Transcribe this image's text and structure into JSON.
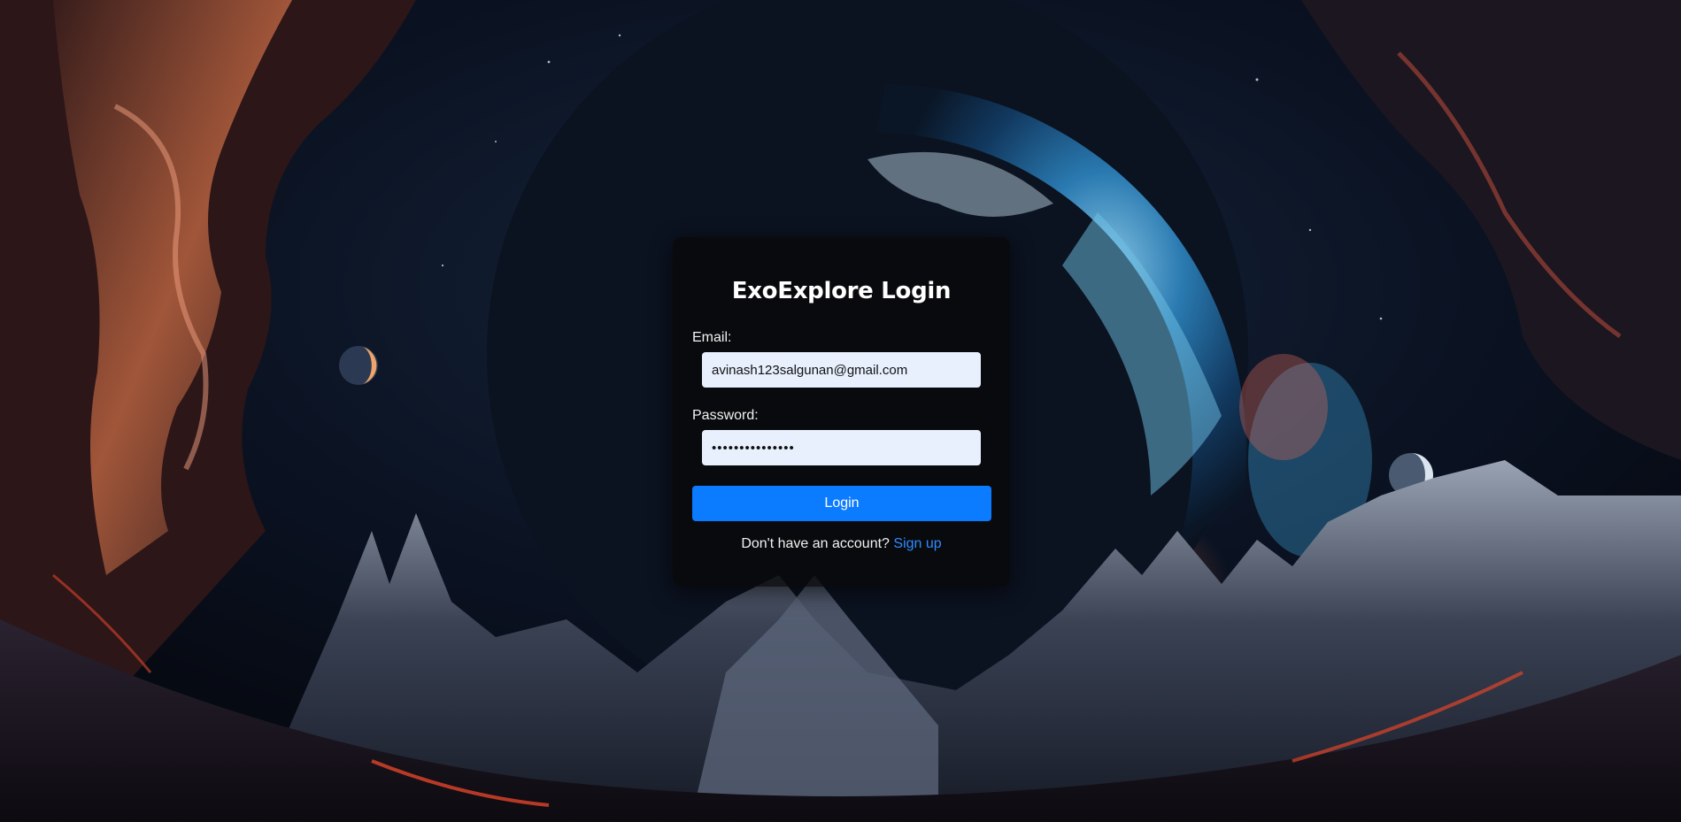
{
  "login": {
    "title": "ExoExplore Login",
    "email_label": "Email:",
    "email_value": "avinash123salgunan@gmail.com",
    "password_label": "Password:",
    "password_value": "avinash12345678",
    "button_label": "Login",
    "signup_prompt": "Don't have an account?",
    "signup_link": "Sign up"
  },
  "colors": {
    "button": "#0b7bff",
    "link": "#2f8bff",
    "input_bg": "#e8f0fe",
    "card_bg": "rgba(8,8,10,0.82)"
  }
}
